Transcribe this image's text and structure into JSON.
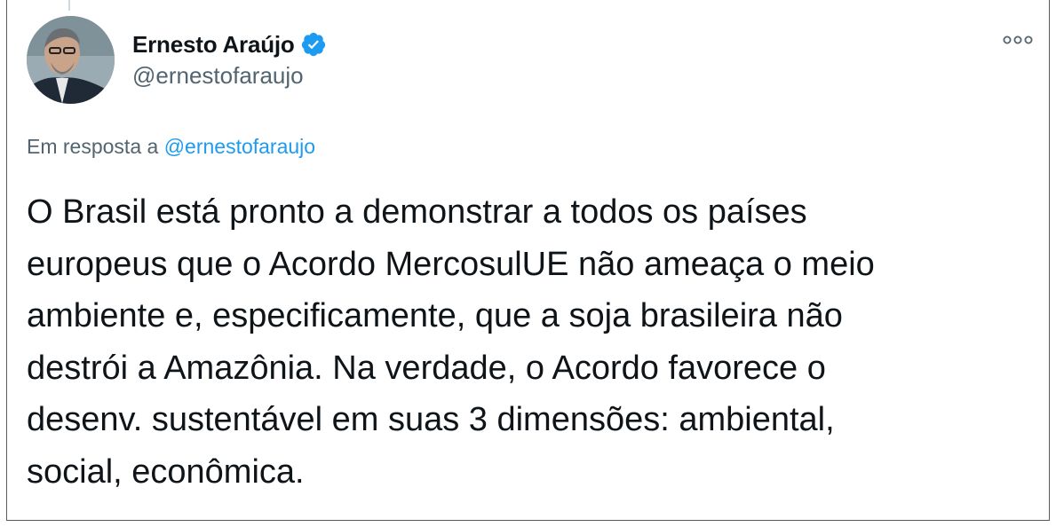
{
  "author": {
    "display_name": "Ernesto Araújo",
    "handle": "@ernestofaraujo",
    "verified": true,
    "avatar_icon": "profile-photo"
  },
  "reply": {
    "prefix": "Em resposta a",
    "mention": "@ernestofaraujo"
  },
  "tweet": {
    "lines": [
      "O Brasil está pronto a demonstrar a todos os países",
      "europeus que o Acordo MercosulUE não ameaça o meio",
      "ambiente e, especificamente, que a soja brasileira não",
      "destrói a Amazônia. Na verdade, o Acordo favorece o",
      "desenv. sustentável em suas 3 dimensões: ambiental,",
      "social, econômica."
    ]
  },
  "icons": {
    "verified": "verified-badge-icon",
    "more": "more-options-icon"
  },
  "colors": {
    "text": "#0f1419",
    "secondary": "#536471",
    "link": "#1d9bf0",
    "border": "#5a5a5a"
  }
}
